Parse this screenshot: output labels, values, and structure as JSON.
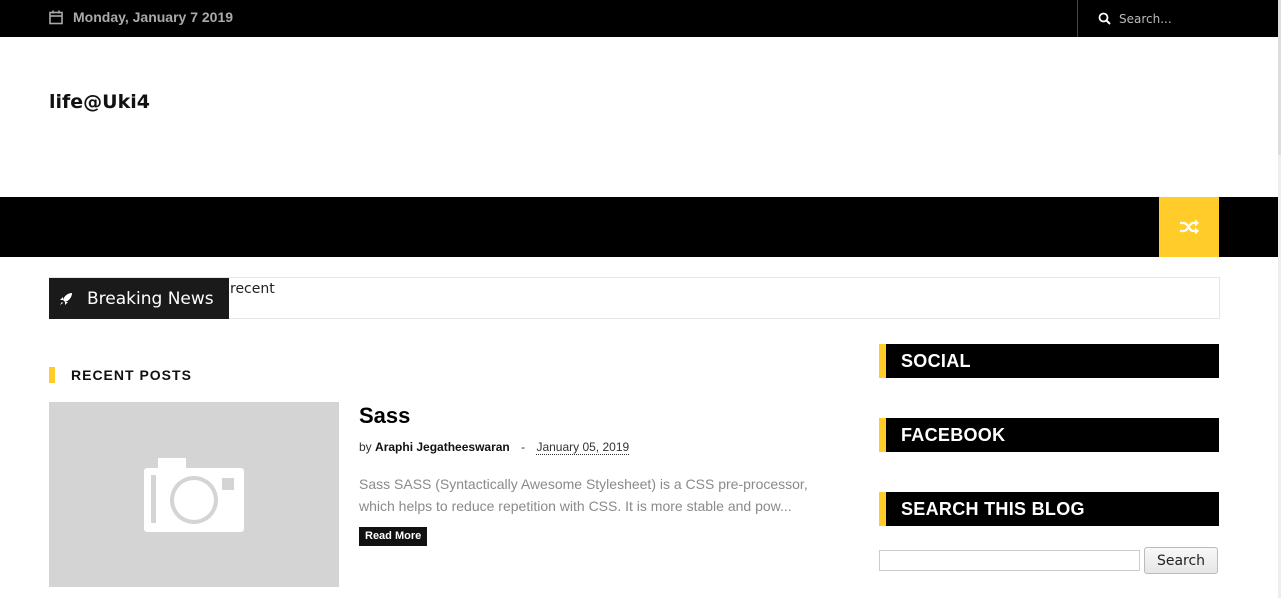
{
  "topbar": {
    "date": "Monday, January 7 2019",
    "search_placeholder": "Search...",
    "calendar_icon": "calendar-icon",
    "search_icon": "search-icon"
  },
  "header": {
    "site_title": "life@Uki4"
  },
  "navbar": {
    "shuffle_icon": "shuffle-icon"
  },
  "breaking": {
    "label": "Breaking News",
    "ticker_text": "recent",
    "icon": "rocket-icon"
  },
  "recent_posts": {
    "heading": "RECENT POSTS",
    "posts": [
      {
        "title": "Sass",
        "by": "by",
        "author": "Araphi Jegatheeswaran",
        "separator": "-",
        "date": "January 05, 2019",
        "excerpt": "Sass SASS (Syntactically Awesome Stylesheet) is a CSS pre-processor, which helps to reduce repetition with CSS. It is more stable and pow...",
        "read_more": "Read More",
        "thumb_icon": "camera-icon"
      }
    ]
  },
  "sidebar": {
    "widgets": [
      "SOCIAL",
      "FACEBOOK",
      "SEARCH THIS BLOG"
    ],
    "search_button": "Search"
  },
  "colors": {
    "accent": "#ffcc29",
    "bar": "#000000"
  }
}
